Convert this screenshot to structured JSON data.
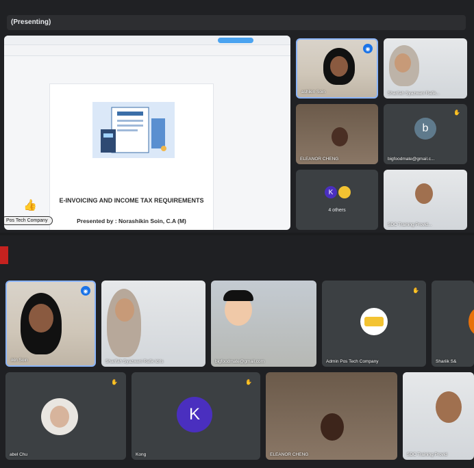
{
  "header": {
    "presenting_label": "(Presenting)"
  },
  "slide": {
    "title": "E-INVOICING AND INCOME TAX REQUIREMENTS",
    "subtitle": "Presented by : Norashikin Soin, C.A (M)"
  },
  "presenter_chip": "Pos Tech Company",
  "top_tiles": [
    {
      "name": "ashikin Soin"
    },
    {
      "name": "Sharifah Syazwani Rafik..."
    },
    {
      "name": "ELEANOR CHENG"
    },
    {
      "name": "bigfoodmate@gmail.c...",
      "initial": "b"
    },
    {
      "name": "4 others",
      "initial": "K"
    },
    {
      "name": "SDC Training Provid..."
    }
  ],
  "bottom_tiles": [
    {
      "name": "ikin Soin"
    },
    {
      "name": "Sharifah Syazwani Rafik Idris"
    },
    {
      "name": "bigfoodmate@gmail.com"
    },
    {
      "name": "Admin Pos Tech Company",
      "logo": "pos"
    },
    {
      "name": "Shariik S&"
    },
    {
      "name": "abel Chu"
    },
    {
      "name": "Kong",
      "initial": "K"
    },
    {
      "name": "ELEANOR CHENG"
    },
    {
      "name": "SDC Training Provid"
    }
  ],
  "colors": {
    "accent_blue": "#1a73e8",
    "tile": "#3c4043",
    "avatar_purple": "#4a2fbf",
    "avatar_slate": "#5f7a8c"
  }
}
